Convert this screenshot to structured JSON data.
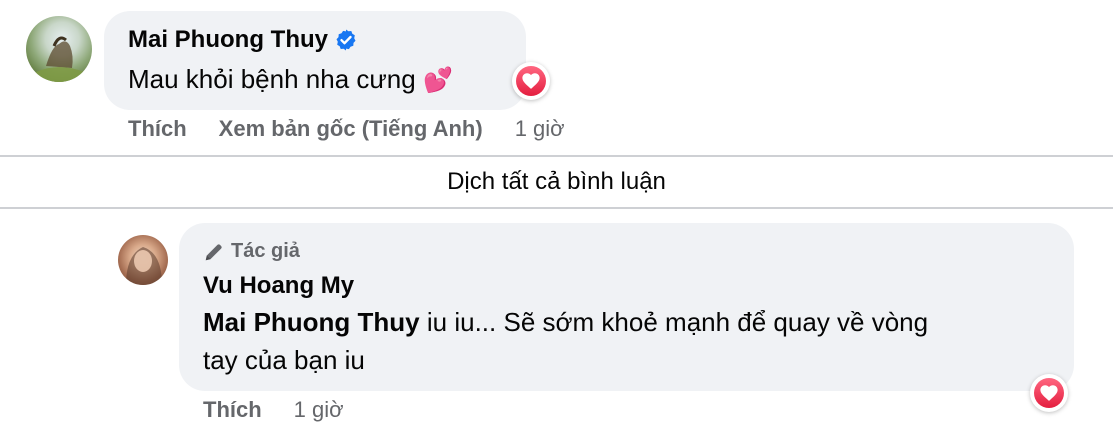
{
  "comment_1": {
    "author": "Mai Phuong Thuy",
    "text": "Mau khỏi bệnh nha cưng",
    "emoji": "💕",
    "actions": {
      "like": "Thích",
      "see_original": "Xem bản gốc (Tiếng Anh)",
      "time": "1 giờ"
    },
    "reaction": "heart"
  },
  "translate_all": "Dịch tất cả bình luận",
  "reply_1": {
    "badge": "Tác giả",
    "author": "Vu Hoang My",
    "mention": "Mai Phuong Thuy",
    "text_line_1": " iu iu... Sẽ sớm khoẻ mạnh để quay về vòng",
    "text_line_2": "tay của bạn iu",
    "actions": {
      "like": "Thích",
      "time": "1 giờ"
    },
    "reaction": "heart"
  },
  "colors": {
    "bubble": "#f0f2f5",
    "secondary_text": "#65676b",
    "verified_blue": "#1877f2",
    "heart_red": "#e41e3f"
  }
}
